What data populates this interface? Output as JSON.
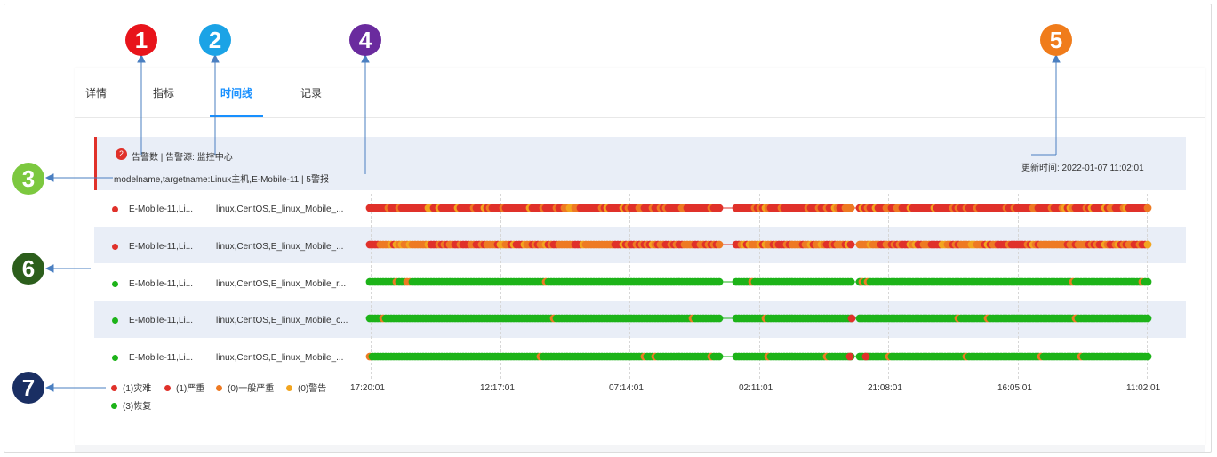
{
  "tabs": [
    {
      "label": "详情"
    },
    {
      "label": "指标"
    },
    {
      "label": "时间线"
    },
    {
      "label": "记录"
    }
  ],
  "active_tab": "时间线",
  "info": {
    "badge_count": "2",
    "source_text": "告警数 | 告警源: 监控中心",
    "model_line": "modelname,targetname:Linux主机,E-Mobile-11   |   5警报",
    "update_time": "更新时间: 2022-01-07 11:02:01"
  },
  "rows": [
    {
      "name": "E-Mobile-11,Li...",
      "tags": "linux,CentOS,E_linux_Mobile_...",
      "status": "critical"
    },
    {
      "name": "E-Mobile-11,Li...",
      "tags": "linux,CentOS,E_linux_Mobile_...",
      "status": "critical"
    },
    {
      "name": "E-Mobile-11,Li...",
      "tags": "linux,CentOS,E_linux_Mobile_r...",
      "status": "recovered"
    },
    {
      "name": "E-Mobile-11,Li...",
      "tags": "linux,CentOS,E_linux_Mobile_c...",
      "status": "recovered"
    },
    {
      "name": "E-Mobile-11,Li...",
      "tags": "linux,CentOS,E_linux_Mobile_...",
      "status": "recovered"
    }
  ],
  "time_axis": [
    "17:20:01",
    "12:17:01",
    "07:14:01",
    "02:11:01",
    "21:08:01",
    "16:05:01",
    "11:02:01"
  ],
  "legend": [
    {
      "label": "(1)灾难",
      "color": "#e0312a"
    },
    {
      "label": "(1)严重",
      "color": "#e0312a"
    },
    {
      "label": "(0)一般严重",
      "color": "#ee7a23"
    },
    {
      "label": "(0)警告",
      "color": "#f2a51f"
    },
    {
      "label": "(3)恢复",
      "color": "#1db319"
    }
  ],
  "callouts": [
    {
      "label": "1",
      "color": "#e8141b"
    },
    {
      "label": "2",
      "color": "#1ba3e6"
    },
    {
      "label": "3",
      "color": "#7cc83f"
    },
    {
      "label": "4",
      "color": "#6a2b9e"
    },
    {
      "label": "5",
      "color": "#f07c1b"
    },
    {
      "label": "6",
      "color": "#2c5e1c"
    },
    {
      "label": "7",
      "color": "#1a2f63"
    }
  ],
  "colors": {
    "critical": "#e0312a",
    "general": "#ee7a23",
    "warning": "#f2a51f",
    "recovered": "#1db319",
    "accent": "#1890ff"
  }
}
